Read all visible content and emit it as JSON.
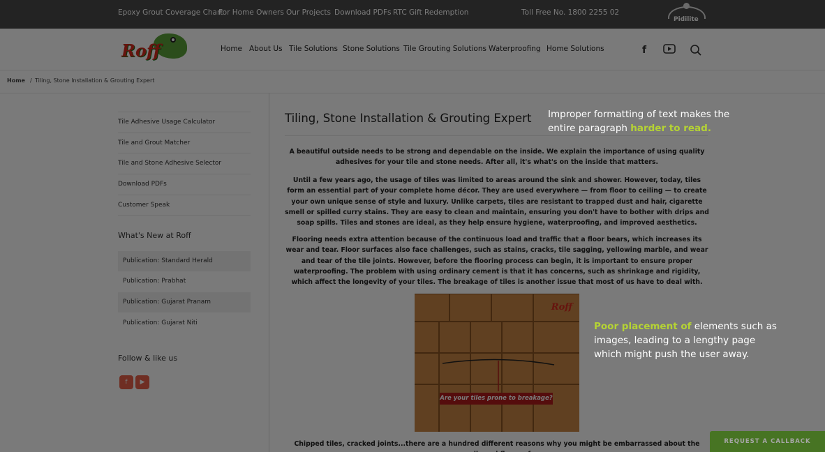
{
  "topbar": {
    "links": [
      "Epoxy Grout Coverage Chart",
      "For Home Owners",
      "Our Projects",
      "Download PDFs",
      "RTC Gift Redemption"
    ],
    "toll_free": "Toll Free No. 1800 2255 02",
    "pidilite_logo": "Pidilite"
  },
  "header": {
    "logo_text": "Roff",
    "logo_tagline": "Roff — tiling expert",
    "nav": [
      "Home",
      "About Us",
      "Tile Solutions",
      "Stone Solutions",
      "Tile Grouting Solutions",
      "Waterproofing",
      "Home Solutions"
    ],
    "icons": [
      "facebook-icon",
      "youtube-icon",
      "search-icon"
    ]
  },
  "breadcrumb": {
    "home": "Home",
    "separator": "/",
    "current": "Tiling, Stone Installation & Grouting Expert"
  },
  "sidebar": {
    "links": [
      "Tile Adhesive Usage Calculator",
      "Tile and Grout Matcher",
      "Tile and Stone Adhesive Selector",
      "Download PDFs",
      "Customer Speak"
    ],
    "news_heading": "What's New at Roff",
    "news": [
      "Publication: Standard Herald",
      "Publication: Prabhat",
      "Publication: Gujarat Pranam",
      "Publication: Gujarat Niti"
    ],
    "follow_heading": "Follow & like us",
    "social": [
      "f",
      "▶"
    ]
  },
  "main": {
    "title": "Tiling, Stone Installation & Grouting Expert",
    "paragraphs": [
      "A beautiful outside needs to be strong and dependable on the inside. We explain the importance of using quality adhesives for your tile and stone needs. After all, it's what's on the inside that matters.",
      "Until a few years ago, the usage of tiles was limited to areas around the sink and shower. However, today, tiles form an essential part of your complete home décor. They are used everywhere — from floor to ceiling — to create your own unique sense of style and luxury. Unlike carpets, tiles are resistant to trapped dust and hair, cigarette smell or spilled curry stains. They are easy to clean and maintain, ensuring you don't have to bother with drips and soap spills. Tiles and stones are ideal, as they help ensure hygiene, waterproofing, and improved aesthetics.",
      "Flooring needs extra attention because of the continuous load and traffic that a floor bears, which increases its wear and tear. Floor surfaces also face challenges, such as stains, cracks, tile sagging, yellowing marble, and wear and tear of the tile joints. However, before the flooring process can begin, it is important to ensure proper waterproofing. The problem with using ordinary cement is that it has concerns, such as shrinkage and rigidity, which affect the longevity of your tiles. The breakage of tiles is another issue that most of us have to deal with.",
      "Chipped tiles, cracked joints...there are a hundred different reasons why you might be embarrassed about the walls and floors of"
    ],
    "figure_brand": "Roff",
    "figure_banner": "Are your tiles prone to breakage?"
  },
  "annotations": {
    "a1_text": "Improper formatting of text makes the entire paragraph",
    "a1_highlight": "harder to read.",
    "a2_highlight": "Poor placement of",
    "a2_text": "elements such as images, leading to a lengthy page which might push the user away."
  },
  "callback_label": "REQUEST A CALLBACK"
}
